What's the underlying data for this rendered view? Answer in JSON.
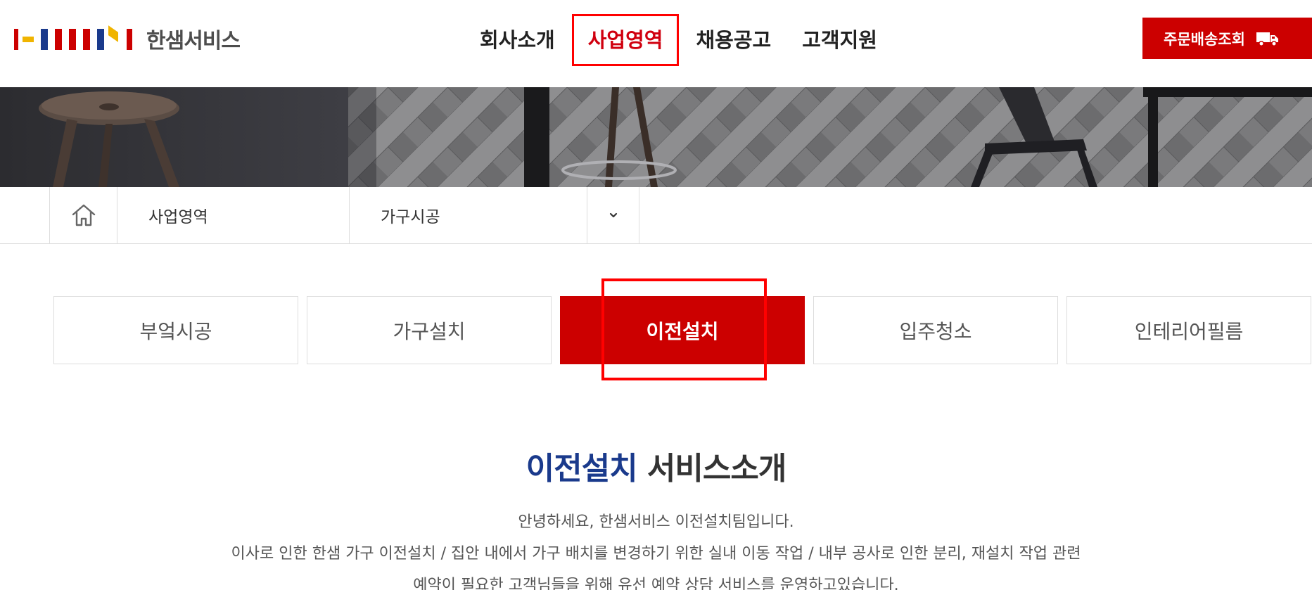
{
  "header": {
    "logo_text": "한샘서비스",
    "nav": [
      {
        "label": "회사소개",
        "active": false
      },
      {
        "label": "사업영역",
        "active": true
      },
      {
        "label": "채용공고",
        "active": false
      },
      {
        "label": "고객지원",
        "active": false
      }
    ],
    "order_button_label": "주문배송조회",
    "order_button_icon": "truck-icon"
  },
  "location": {
    "home_icon": "home-icon",
    "depth1": "사업영역",
    "depth2": "가구시공",
    "toggle_icon": "chevron-down-icon"
  },
  "tabs": [
    {
      "label": "부엌시공",
      "active": false
    },
    {
      "label": "가구설치",
      "active": false
    },
    {
      "label": "이전설치",
      "active": true
    },
    {
      "label": "입주청소",
      "active": false
    },
    {
      "label": "인테리어필름",
      "active": false
    }
  ],
  "intro": {
    "title_accent": "이전설치",
    "title_rest": "서비스소개",
    "lines": [
      "안녕하세요, 한샘서비스 이전설치팀입니다.",
      "이사로 인한 한샘 가구 이전설치 / 집안 내에서 가구 배치를 변경하기 위한 실내 이동 작업 / 내부 공사로 인한 분리, 재설치 작업 관련",
      "예약이 필요한 고객님들을 위해 유선 예약 상담 서비스를 운영하고있습니다."
    ]
  },
  "colors": {
    "brand_red": "#cc0000",
    "accent_blue": "#1a3a8c",
    "highlight_red": "#ff0000"
  }
}
